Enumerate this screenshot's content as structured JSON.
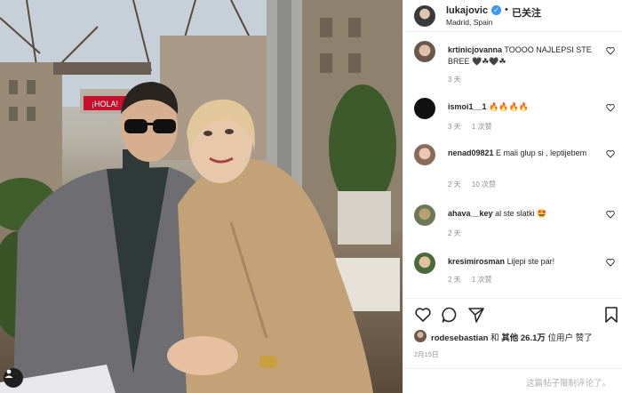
{
  "header": {
    "username": "lukajovic",
    "follow_label": "已关注",
    "location": "Madrid, Spain",
    "separator": "•"
  },
  "photo": {
    "sign_text": "¡HOLA!"
  },
  "comments": [
    {
      "user": "krtinicjovanna",
      "text": "TOOOO NAJLEPSI STE BREE 🖤☘🖤☘",
      "age": "3 天",
      "likes": ""
    },
    {
      "user": "ismoi1__1",
      "text": "🔥🔥🔥🔥",
      "age": "3 天",
      "likes": "1 次赞"
    },
    {
      "user": "nenad09821",
      "text": "E mali glup si , leptijebem",
      "age": "2 天",
      "likes": "10 次赞"
    },
    {
      "user": "ahava__key",
      "text": "al ste slatki 🤩",
      "age": "2 天",
      "likes": ""
    },
    {
      "user": "kresimirosman",
      "text": "Lijepi ste par!",
      "age": "2 天",
      "likes": "1 次赞"
    }
  ],
  "likes": {
    "liker": "rodesebastian",
    "connector": "和",
    "others_label": "其他",
    "count": "26.1万",
    "suffix": "位用户 赞了"
  },
  "date": "2月15日",
  "footer": {
    "comments_limited": "这篇帖子限制评论了。"
  },
  "colors": {
    "verified": "#3897f0",
    "muted": "#8e8e8e",
    "border": "#efefef"
  },
  "icons": [
    "heart-icon",
    "comment-icon",
    "share-icon",
    "bookmark-icon",
    "verified-icon",
    "user-tag-icon"
  ]
}
